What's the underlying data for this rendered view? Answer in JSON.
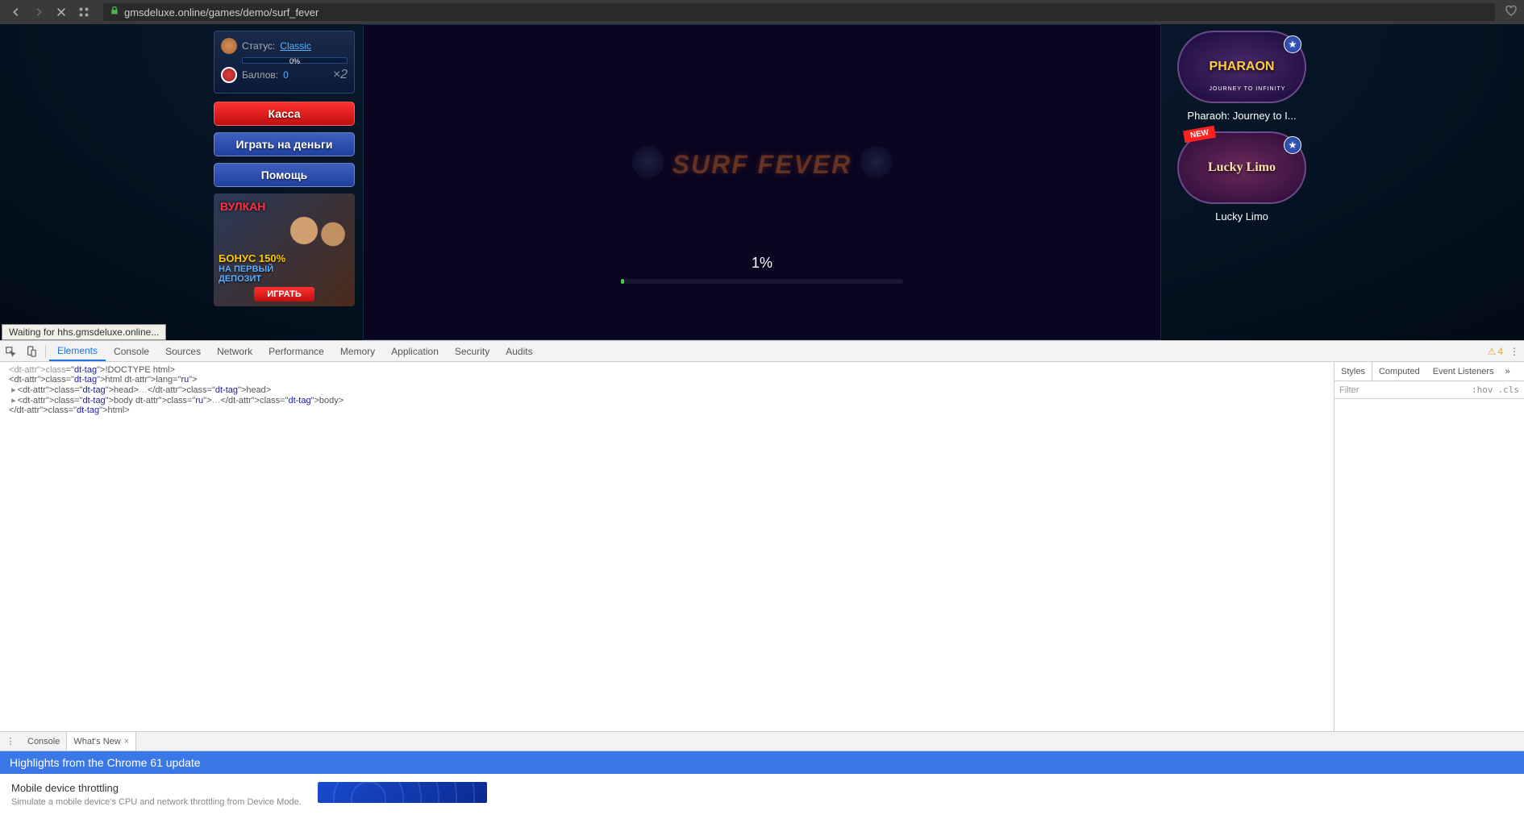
{
  "browser": {
    "url": "gmsdeluxe.online/games/demo/surf_fever",
    "status_text": "Waiting for hhs.gmsdeluxe.online..."
  },
  "sidebar_left": {
    "status_label": "Статус:",
    "status_value": "Classic",
    "progress_text": "0%",
    "points_label": "Баллов:",
    "points_value": "0",
    "multiplier": "×2",
    "btn_kassa": "Касса",
    "btn_play": "Играть на деньги",
    "btn_help": "Помощь",
    "promo": {
      "logo": "ВУЛКАН",
      "line1": "БОНУС 150%",
      "line2": "НА ПЕРВЫЙ",
      "line3": "ДЕПОЗИТ",
      "btn": "ИГРАТЬ"
    }
  },
  "game": {
    "logo": "SURF FEVER",
    "load_percent": "1%"
  },
  "sidebar_right": {
    "cards": [
      {
        "thumb_label": "PHARAON",
        "thumb_sub": "JOURNEY TO INFINITY",
        "title": "Pharaoh: Journey to I...",
        "new": false
      },
      {
        "thumb_label": "Lucky Limo",
        "thumb_sub": "",
        "title": "Lucky Limo",
        "new": true
      }
    ]
  },
  "devtools": {
    "tabs": [
      "Elements",
      "Console",
      "Sources",
      "Network",
      "Performance",
      "Memory",
      "Application",
      "Security",
      "Audits"
    ],
    "active_tab": "Elements",
    "warn_count": "4",
    "html_lines": [
      {
        "text": "<!DOCTYPE html>",
        "gray": true,
        "indent": 0,
        "arrow": false
      },
      {
        "text": "<html lang=\"ru\">",
        "gray": false,
        "indent": 0,
        "arrow": false
      },
      {
        "text": "<head>…</head>",
        "gray": false,
        "indent": 1,
        "arrow": true
      },
      {
        "text": "<body class=\"ru\">…</body>",
        "gray": false,
        "indent": 1,
        "arrow": true
      },
      {
        "text": "</html>",
        "gray": false,
        "indent": 0,
        "arrow": false
      }
    ],
    "styles_tabs": [
      "Styles",
      "Computed",
      "Event Listeners"
    ],
    "filter_label": "Filter",
    "filter_hov": ":hov",
    "filter_cls": ".cls",
    "drawer_tabs": [
      "Console",
      "What's New"
    ],
    "drawer_active": "What's New",
    "banner": "Highlights from the Chrome 61 update",
    "feature_title": "Mobile device throttling",
    "feature_desc": "Simulate a mobile device's CPU and network throttling from Device Mode."
  }
}
